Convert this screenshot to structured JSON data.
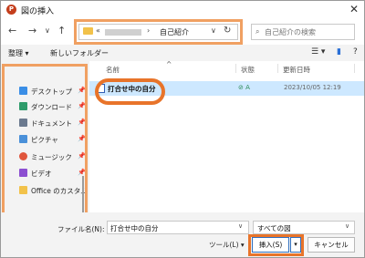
{
  "window": {
    "title": "図の挿入",
    "close": "✕"
  },
  "nav": {
    "back": "←",
    "forward": "→",
    "dropdown": "∨",
    "up": "↑"
  },
  "address": {
    "prefix": "«",
    "separator": "›",
    "current": "自己紹介",
    "dropdown": "∨",
    "refresh": "↻"
  },
  "search": {
    "placeholder": "自己紹介の検索",
    "icon": "⌕"
  },
  "toolbar": {
    "organize": "整理 ▾",
    "new_folder": "新しいフォルダー",
    "view": "☰ ▾",
    "pane": "▮",
    "help": "?"
  },
  "sidebar": {
    "items": [
      {
        "label": "デスクトップ",
        "pin": "📌",
        "color": "#3a8ee6"
      },
      {
        "label": "ダウンロード",
        "pin": "📌",
        "color": "#2e9b6a"
      },
      {
        "label": "ドキュメント",
        "pin": "📌",
        "color": "#6b7a8f"
      },
      {
        "label": "ピクチャ",
        "pin": "📌",
        "color": "#4a90d9"
      },
      {
        "label": "ミュージック",
        "pin": "📌",
        "color": "#e0563d"
      },
      {
        "label": "ビデオ",
        "pin": "📌",
        "color": "#8c4fd1"
      },
      {
        "label": "Office のカスタム",
        "pin": "",
        "color": "#f2c24a"
      }
    ]
  },
  "columns": {
    "name": "名前",
    "sort": "^",
    "status": "状態",
    "date": "更新日時"
  },
  "files": [
    {
      "name": "打合せ中の自分",
      "status": "⊘ 𝖠",
      "date": "2023/10/05 12:19"
    }
  ],
  "bottom": {
    "filename_label": "ファイル名(N):",
    "filename_value": "打合せ中の自分",
    "filename_dd": "∨",
    "type_value": "すべての図",
    "type_dd": "∨",
    "tools": "ツール(L) ▾",
    "insert": "挿入(S)",
    "insert_dd": "▾",
    "cancel": "キャンセル"
  },
  "colors": {
    "highlight": "#e8742a",
    "selection": "#cde8ff",
    "accent": "#3070c0"
  }
}
